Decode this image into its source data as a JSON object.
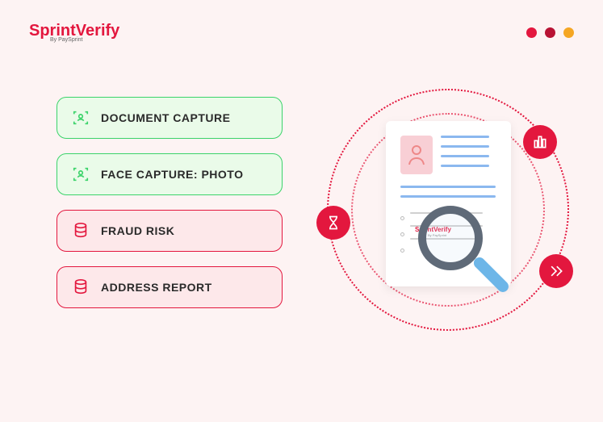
{
  "brand": {
    "name_part1": "Sprint",
    "name_part2": "erify",
    "tagline": "By PaySprint"
  },
  "window_dots": [
    "red",
    "darkred",
    "orange"
  ],
  "pills": [
    {
      "label": "DOCUMENT CAPTURE",
      "variant": "green",
      "icon": "face-scan-icon"
    },
    {
      "label": "FACE CAPTURE: PHOTO",
      "variant": "green",
      "icon": "face-scan-icon"
    },
    {
      "label": "FRAUD RISK",
      "variant": "red",
      "icon": "database-icon"
    },
    {
      "label": "ADDRESS REPORT",
      "variant": "red",
      "icon": "database-icon"
    }
  ],
  "badges": {
    "left": "hourglass-icon",
    "top": "bar-chart-icon",
    "right": "fast-forward-icon"
  },
  "colors": {
    "brand_red": "#e3173e",
    "success_green": "#3bd36a",
    "doc_line_blue": "#8bb8ef"
  }
}
